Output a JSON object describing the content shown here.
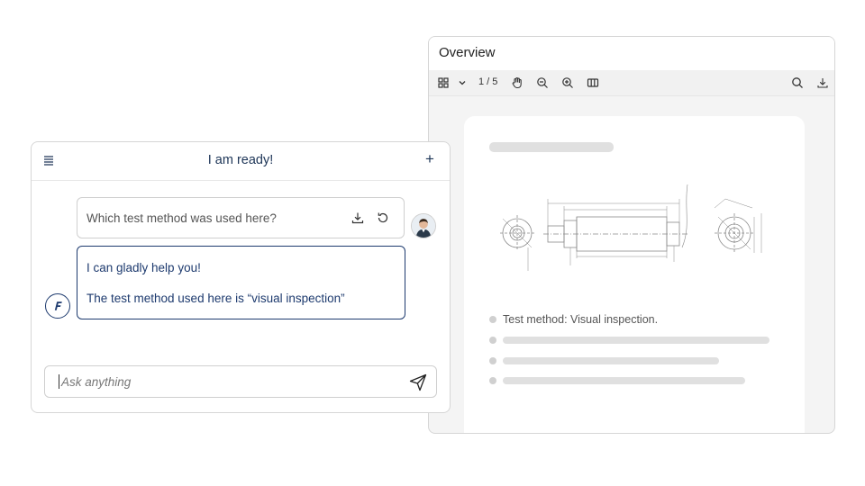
{
  "overview": {
    "title": "Overview",
    "page_indicator": "1 / 5",
    "toolbar_icons": [
      "grid-icon",
      "chevron-down-icon",
      "hand-icon",
      "zoom-out-icon",
      "zoom-in-icon",
      "columns-icon",
      "search-icon",
      "download-icon"
    ],
    "document": {
      "bullet_text": "Test method: Visual inspection."
    }
  },
  "chat": {
    "header_title": "I am ready!",
    "plus_symbol": "+",
    "question": "Which test method was used here?",
    "answer_line1": "I can gladly help you!",
    "answer_line2": "The test method used here is “visual inspection”",
    "input_placeholder": "Ask anything",
    "accent_color": "#1d3a6e"
  }
}
